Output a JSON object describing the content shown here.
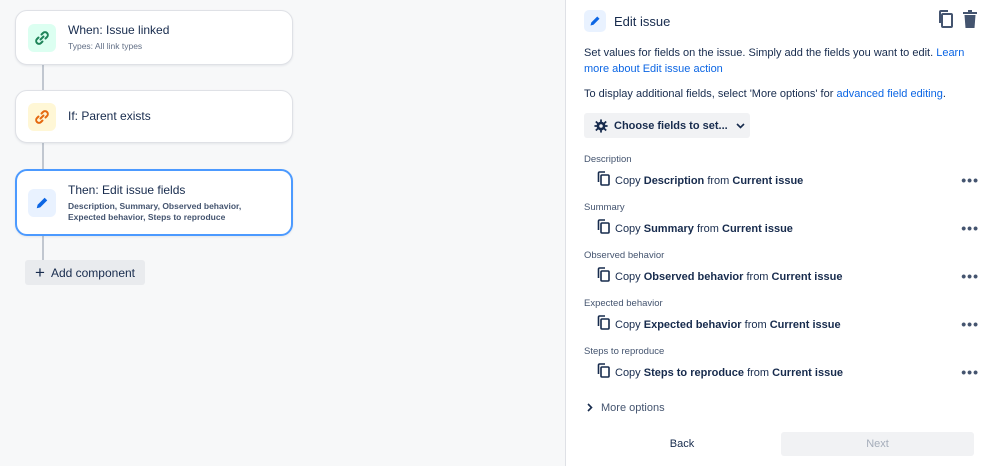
{
  "canvas": {
    "nodes": [
      {
        "title": "When: Issue linked",
        "subtitle": "Types: All link types",
        "icon": "link-icon",
        "color": "#1f845a"
      },
      {
        "title": "If: Parent exists",
        "subtitle": "",
        "icon": "link-icon",
        "color": "#e56910"
      },
      {
        "title": "Then: Edit issue fields",
        "subtitle": "Description, Summary, Observed behavior, Expected behavior, Steps to reproduce",
        "icon": "pencil-icon",
        "color": "#0c66e4"
      }
    ],
    "add_component_label": "Add component"
  },
  "panel": {
    "title": "Edit issue",
    "intro_text": "Set values for fields on the issue. Simply add the fields you want to edit.",
    "intro_link": "Learn more about Edit issue action",
    "intro2_text": "To display additional fields, select 'More options' for",
    "intro2_link": "advanced field editing",
    "intro2_end": ".",
    "choose_fields_label": "Choose fields to set...",
    "copy_word": "Copy",
    "from_word": "from",
    "fields": [
      {
        "label": "Description",
        "field": "Description",
        "source": "Current issue"
      },
      {
        "label": "Summary",
        "field": "Summary",
        "source": "Current issue"
      },
      {
        "label": "Observed behavior",
        "field": "Observed behavior",
        "source": "Current issue"
      },
      {
        "label": "Expected behavior",
        "field": "Expected behavior",
        "source": "Current issue"
      },
      {
        "label": "Steps to reproduce",
        "field": "Steps to reproduce",
        "source": "Current issue"
      }
    ],
    "more_options_label": "More options",
    "back_label": "Back",
    "next_label": "Next"
  }
}
